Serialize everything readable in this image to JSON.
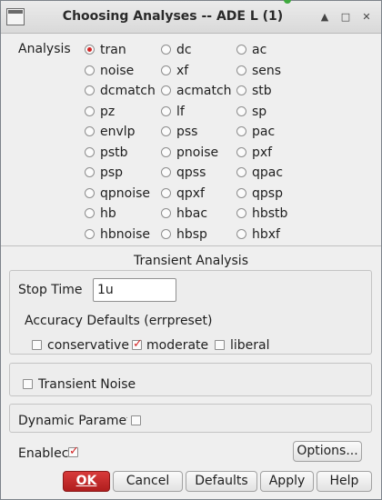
{
  "window": {
    "title": "Choosing Analyses -- ADE L (1)"
  },
  "analysis": {
    "label": "Analysis",
    "selected": "tran",
    "options": [
      [
        "tran",
        "dc",
        "ac"
      ],
      [
        "noise",
        "xf",
        "sens"
      ],
      [
        "dcmatch",
        "acmatch",
        "stb"
      ],
      [
        "pz",
        "lf",
        "sp"
      ],
      [
        "envlp",
        "pss",
        "pac"
      ],
      [
        "pstb",
        "pnoise",
        "pxf"
      ],
      [
        "psp",
        "qpss",
        "qpac"
      ],
      [
        "qpnoise",
        "qpxf",
        "qpsp"
      ],
      [
        "hb",
        "hbac",
        "hbstb"
      ],
      [
        "hbnoise",
        "hbsp",
        "hbxf"
      ]
    ]
  },
  "transient": {
    "section_title": "Transient Analysis",
    "stop_time_label": "Stop Time",
    "stop_time_value": "1u",
    "accuracy_label": "Accuracy Defaults (errpreset)",
    "accuracy_options": [
      {
        "label": "conservative",
        "checked": false
      },
      {
        "label": "moderate",
        "checked": true
      },
      {
        "label": "liberal",
        "checked": false
      }
    ],
    "noise_label": "Transient Noise",
    "dynamic_label": "Dynamic Paramete",
    "enabled_label": "Enablec"
  },
  "buttons": {
    "options": "Options...",
    "ok": "OK",
    "cancel": "Cancel",
    "defaults": "Defaults",
    "apply": "Apply",
    "help": "Help"
  },
  "colors": {
    "accent": "#d32727",
    "ok_button": "#c52a2a"
  }
}
